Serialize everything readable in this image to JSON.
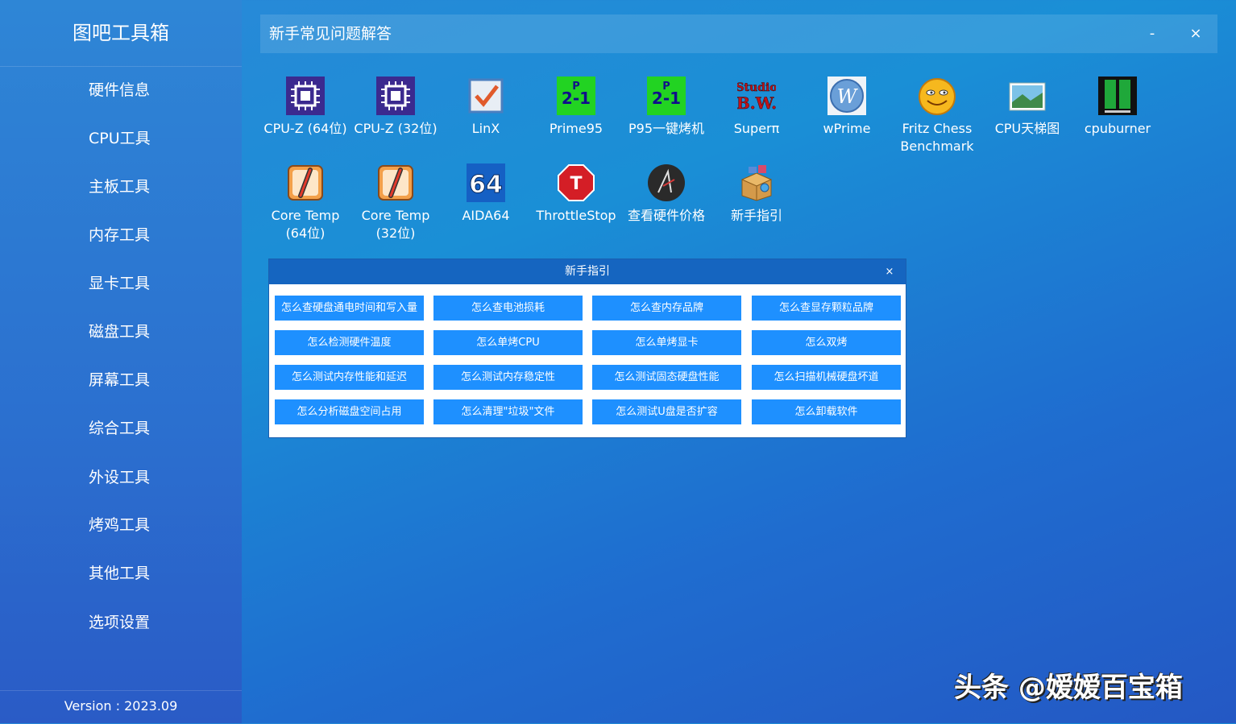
{
  "sidebar": {
    "title": "图吧工具箱",
    "items": [
      {
        "label": "硬件信息"
      },
      {
        "label": "CPU工具"
      },
      {
        "label": "主板工具"
      },
      {
        "label": "内存工具"
      },
      {
        "label": "显卡工具"
      },
      {
        "label": "磁盘工具"
      },
      {
        "label": "屏幕工具"
      },
      {
        "label": "综合工具"
      },
      {
        "label": "外设工具"
      },
      {
        "label": "烤鸡工具"
      },
      {
        "label": "其他工具"
      },
      {
        "label": "选项设置"
      }
    ],
    "version": "Version : 2023.09"
  },
  "header": {
    "title": "新手常见问题解答",
    "minimize": "-",
    "close": "×"
  },
  "tools": [
    {
      "label": "CPU-Z (64位)",
      "icon": "cpu-z-icon"
    },
    {
      "label": "CPU-Z (32位)",
      "icon": "cpu-z-icon"
    },
    {
      "label": "LinX",
      "icon": "linx-icon"
    },
    {
      "label": "Prime95",
      "icon": "prime95-icon"
    },
    {
      "label": "P95一键烤机",
      "icon": "prime95-icon"
    },
    {
      "label": "Superπ",
      "icon": "superpi-icon"
    },
    {
      "label": "wPrime",
      "icon": "wprime-icon"
    },
    {
      "label": "Fritz Chess Benchmark",
      "icon": "fritz-chess-icon"
    },
    {
      "label": "CPU天梯图",
      "icon": "image-icon"
    },
    {
      "label": "cpuburner",
      "icon": "cpuburner-icon"
    },
    {
      "label": "Core Temp (64位)",
      "icon": "thermometer-icon"
    },
    {
      "label": "Core Temp (32位)",
      "icon": "thermometer-icon"
    },
    {
      "label": "AIDA64",
      "icon": "aida64-icon"
    },
    {
      "label": "ThrottleStop",
      "icon": "stop-sign-icon"
    },
    {
      "label": "查看硬件价格",
      "icon": "price-icon"
    },
    {
      "label": "新手指引",
      "icon": "package-icon"
    }
  ],
  "dialog": {
    "title": "新手指引",
    "close": "×",
    "buttons": [
      "怎么查硬盘通电时间和写入量",
      "怎么查电池损耗",
      "怎么查内存品牌",
      "怎么查显存颗粒品牌",
      "怎么检测硬件温度",
      "怎么单烤CPU",
      "怎么单烤显卡",
      "怎么双烤",
      "怎么测试内存性能和延迟",
      "怎么测试内存稳定性",
      "怎么测试固态硬盘性能",
      "怎么扫描机械硬盘坏道",
      "怎么分析磁盘空间占用",
      "怎么清理\"垃圾\"文件",
      "怎么测试U盘是否扩容",
      "怎么卸载软件"
    ]
  },
  "watermark": "头条 @嫒嫒百宝箱"
}
